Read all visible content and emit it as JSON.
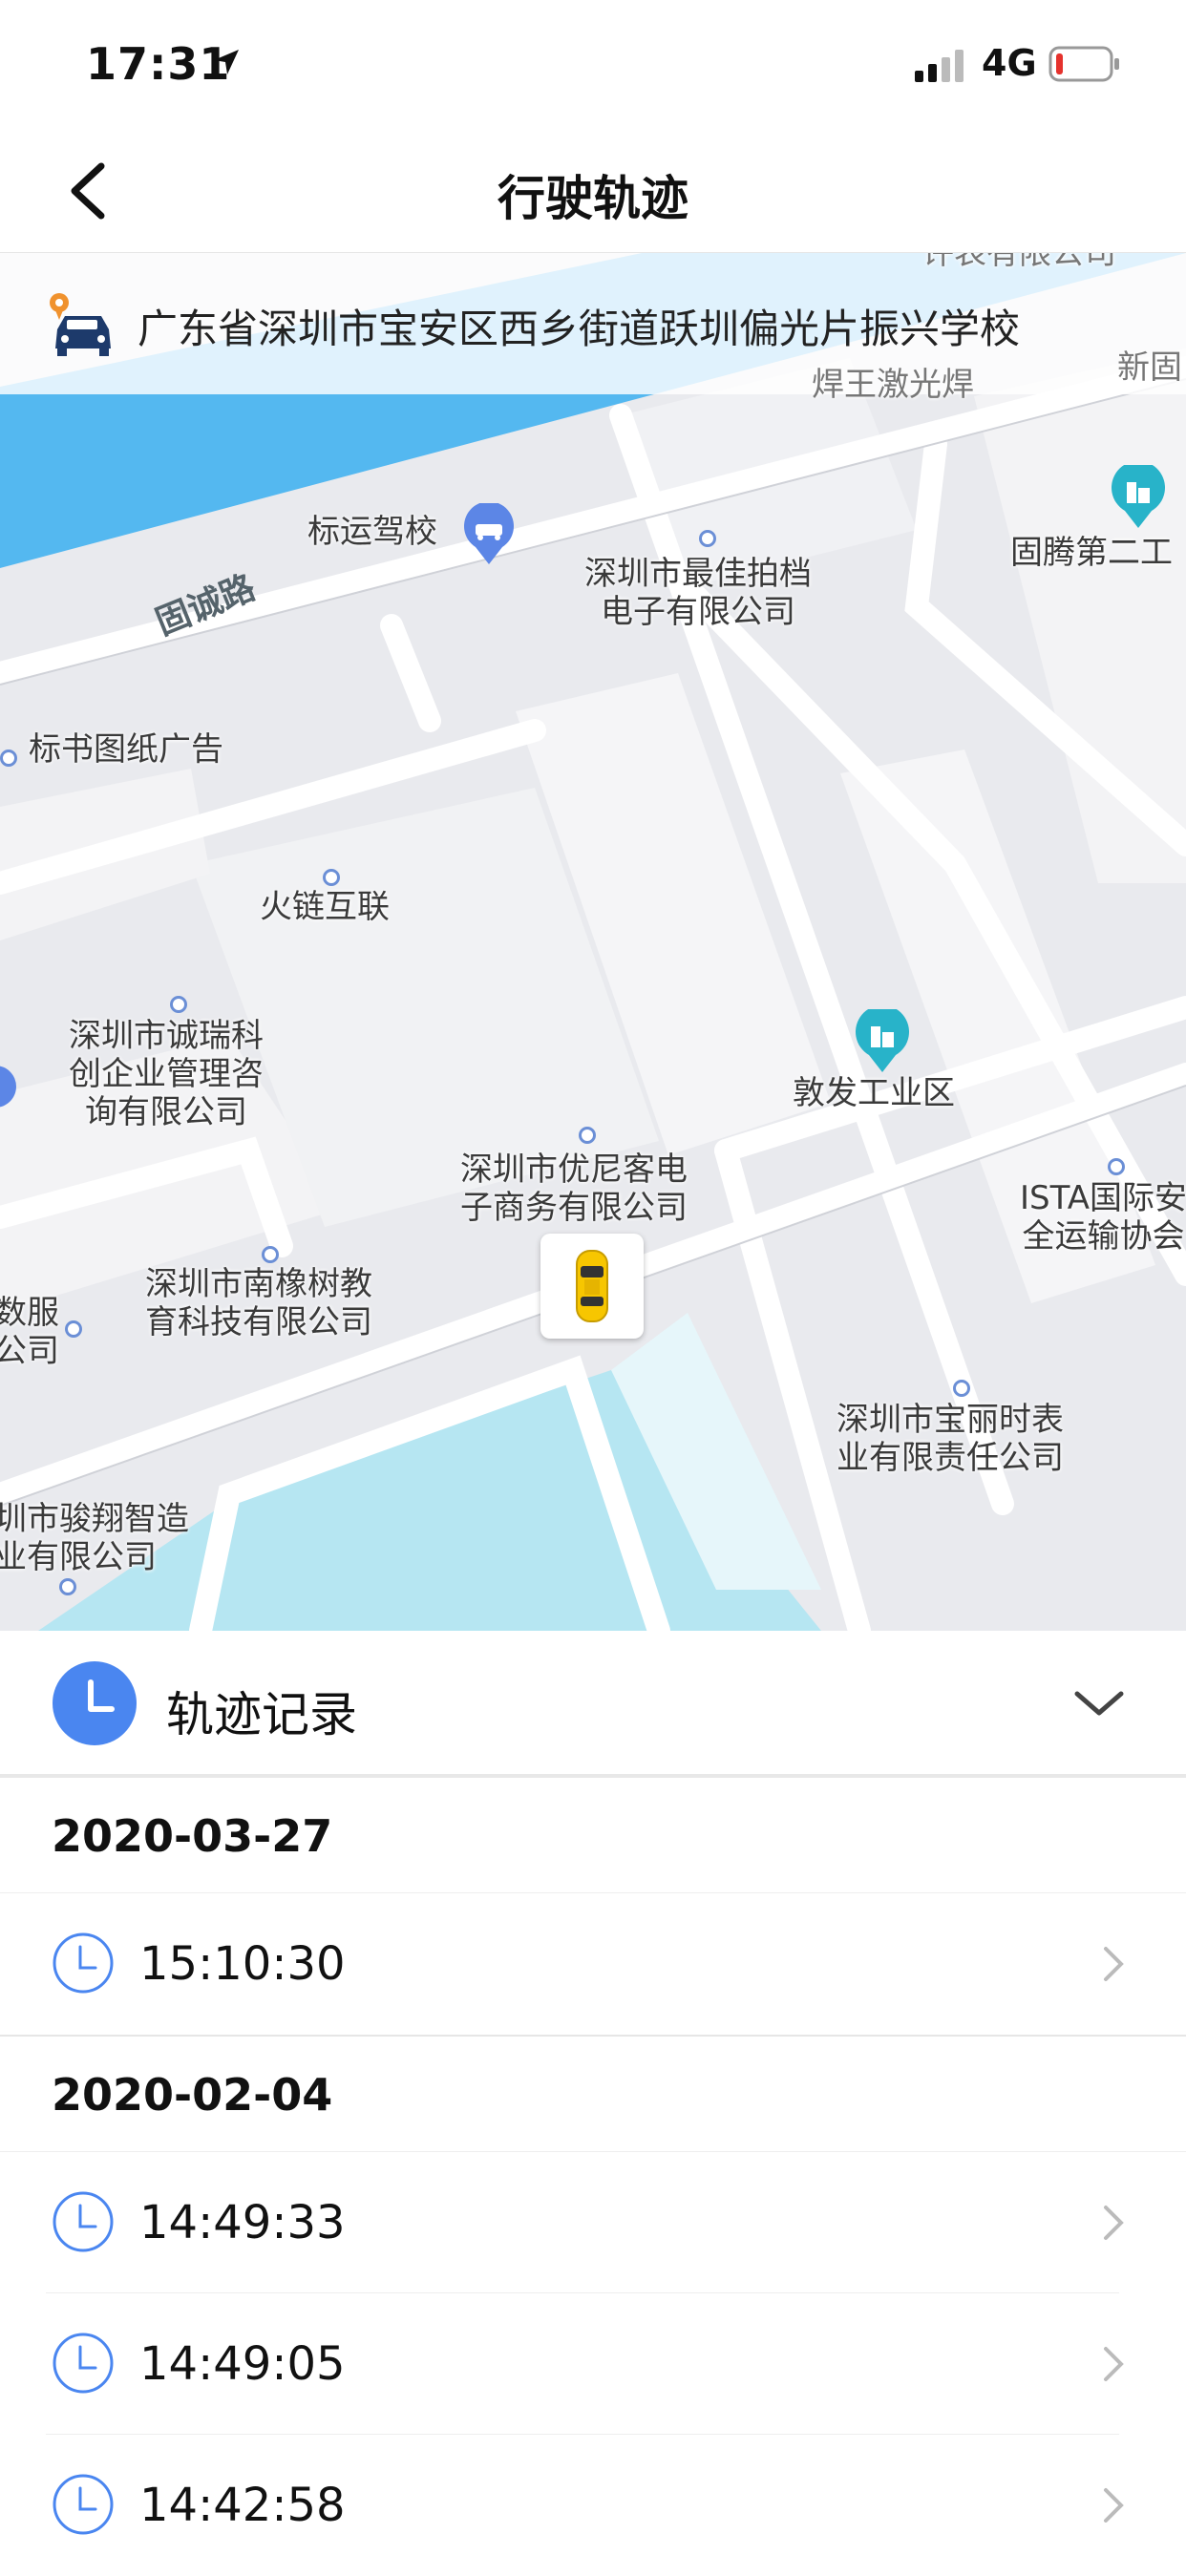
{
  "status_bar": {
    "time": "17:31",
    "network": "4G"
  },
  "nav": {
    "title": "行驶轨迹"
  },
  "map": {
    "address": "广东省深圳市宝安区西乡街道跃圳偏光片振兴学校",
    "road": "固诚路",
    "pois": [
      "标运驾校",
      "深圳市最佳拍档\n电子有限公司",
      "固腾第二工",
      "标书图纸广告",
      "火链互联",
      "深圳市诚瑞科\n创企业管理咨\n询有限公司",
      "敦发工业区",
      "深圳市优尼客电\n子商务有限公司",
      "ISTA国际安\n全运输协会",
      "深圳市南橡树教\n育科技有限公司",
      "深圳市宝丽时表\n业有限责任公司",
      "圳市骏翔智造\n业有限公司",
      "焊王激光焊",
      "新固",
      "许表有限公司",
      "数服\n公司"
    ]
  },
  "records": {
    "title": "轨迹记录",
    "groups": [
      {
        "date": "2020-03-27",
        "times": [
          "15:10:30"
        ]
      },
      {
        "date": "2020-02-04",
        "times": [
          "14:49:33",
          "14:49:05",
          "14:42:58"
        ]
      }
    ]
  },
  "colors": {
    "accent": "#4a86f0",
    "car": "#f7c600",
    "water": "#b6e6f2",
    "river": "#54b8f0"
  }
}
